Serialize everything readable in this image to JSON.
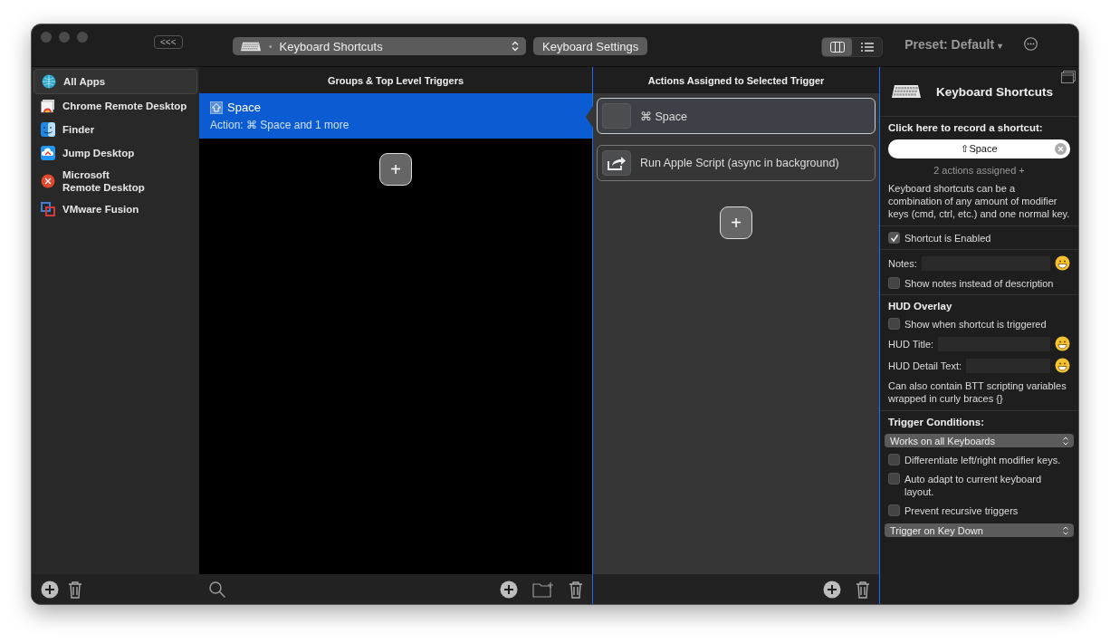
{
  "toolbar": {
    "sidebar_toggle": "<<<",
    "trigger_type": {
      "bullet": "•",
      "value": "Keyboard Shortcuts"
    },
    "settings_button": "Keyboard Settings",
    "views": [
      {
        "kind": "columns",
        "selected": true
      },
      {
        "kind": "list",
        "selected": false
      }
    ],
    "preset": {
      "label": "Preset: Default",
      "caret": "▾"
    }
  },
  "sidebar": {
    "items": [
      {
        "label": "All Apps",
        "kind": "globe",
        "selected": true
      },
      {
        "label": "Chrome Remote Desktop",
        "kind": "chrome",
        "selected": false
      },
      {
        "label": "Finder",
        "kind": "finder",
        "selected": false
      },
      {
        "label": "Jump Desktop",
        "kind": "jump",
        "selected": false
      },
      {
        "label": "Microsoft\nRemote Desktop",
        "kind": "msrd",
        "selected": false
      },
      {
        "label": "VMware Fusion",
        "kind": "vmware",
        "selected": false
      }
    ]
  },
  "triggers": {
    "header": "Groups & Top Level Triggers",
    "items": [
      {
        "title": "Space",
        "subtitle": "Action: ⌘ Space and 1 more",
        "selected": true
      }
    ],
    "add_button": "+"
  },
  "actions": {
    "header": "Actions Assigned to Selected Trigger",
    "items": [
      {
        "label": "⌘ Space",
        "kind": "blank",
        "selected": true
      },
      {
        "label": "Run Apple Script (async in background)",
        "kind": "share",
        "selected": false
      }
    ],
    "add_button": "+"
  },
  "inspector": {
    "title": "Keyboard Shortcuts",
    "record_label": "Click here to record a shortcut:",
    "shortcut_value": "⇧Space",
    "assigned": "2 actions assigned +",
    "description": "Keyboard shortcuts can be a combination of any amount of modifier keys (cmd, ctrl, etc.) and one normal key.",
    "enabled": {
      "label": "Shortcut is Enabled",
      "checked": true
    },
    "notes_label": "Notes:",
    "show_notes": {
      "label": "Show notes instead of description",
      "checked": false
    },
    "hud_title": "HUD Overlay",
    "hud_show": {
      "label": "Show when shortcut is triggered",
      "checked": false
    },
    "hud_title_label": "HUD Title:",
    "hud_detail_label": "HUD Detail Text:",
    "hud_hint": "Can also contain BTT scripting variables wrapped in curly braces {}",
    "conditions_title": "Trigger Conditions:",
    "keyboard_select": "Works on all Keyboards",
    "options": [
      {
        "label": "Differentiate left/right modifier keys.",
        "checked": false
      },
      {
        "label": "Auto adapt to current keyboard layout.",
        "checked": false
      },
      {
        "label": "Prevent recursive triggers",
        "checked": false
      }
    ],
    "trigger_select": "Trigger on Key Down"
  }
}
